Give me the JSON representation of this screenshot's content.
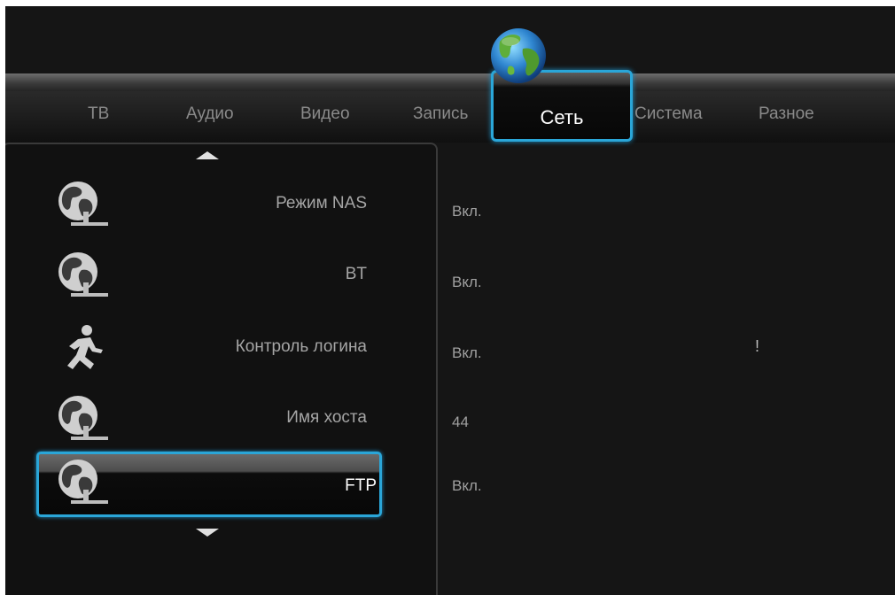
{
  "tabs": {
    "items": [
      {
        "label": "ТВ"
      },
      {
        "label": "Аудио"
      },
      {
        "label": "Видео"
      },
      {
        "label": "Запись"
      },
      {
        "label": "Сеть",
        "active": true
      },
      {
        "label": "Система"
      },
      {
        "label": "Разное"
      }
    ],
    "active_label": "Сеть",
    "active_icon": "globe-icon"
  },
  "menu": {
    "items": [
      {
        "label": "Режим NAS",
        "value": "Вкл.",
        "icon": "network-globe-icon"
      },
      {
        "label": "BT",
        "value": "Вкл.",
        "icon": "network-globe-icon"
      },
      {
        "label": "Контроль логина",
        "value": "Вкл.",
        "icon": "running-man-icon"
      },
      {
        "label": "Имя хоста",
        "value": "44",
        "icon": "network-globe-icon"
      },
      {
        "label": "FTP",
        "value": "Вкл.",
        "icon": "network-globe-icon",
        "selected": true
      }
    ],
    "scroll_up_icon": "arrow-up-icon",
    "scroll_down_icon": "arrow-down-icon"
  },
  "extra": {
    "exclamation": "!"
  },
  "colors": {
    "accent": "#2aa6d8",
    "background": "#151515"
  }
}
